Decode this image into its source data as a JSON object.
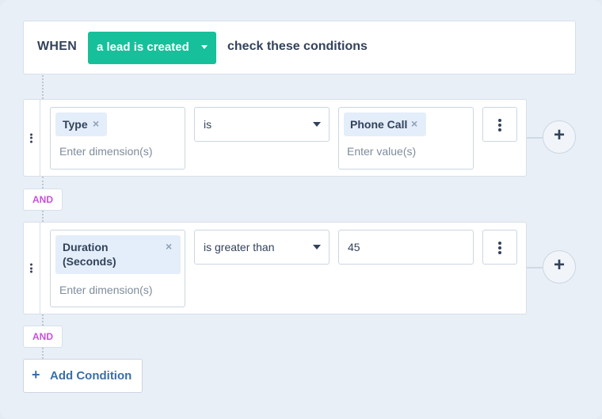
{
  "trigger": {
    "when_label": "WHEN",
    "event_value": "a lead is created",
    "tail_text": "check these conditions"
  },
  "conditions": [
    {
      "dimension_chip": "Type",
      "dimension_placeholder": "Enter dimension(s)",
      "operator": "is",
      "value_chip": "Phone Call",
      "value_placeholder": "Enter value(s)"
    },
    {
      "dimension_chip_line1": "Duration",
      "dimension_chip_line2": "(Seconds)",
      "dimension_placeholder": "Enter dimension(s)",
      "operator": "is greater than",
      "value": "45"
    }
  ],
  "and_label": "AND",
  "add_condition": {
    "icon": "+",
    "label": "Add Condition"
  },
  "icons": {
    "remove": "×",
    "add": "+",
    "more": "vertical-dots-icon",
    "drag": "drag-handle-icon",
    "dropdown": "caret-down-icon"
  },
  "colors": {
    "accent": "#16c09a",
    "and_text": "#c94ee0",
    "link": "#3a6ea8",
    "chip_bg": "#e3eefa",
    "background": "#e9eff6"
  }
}
